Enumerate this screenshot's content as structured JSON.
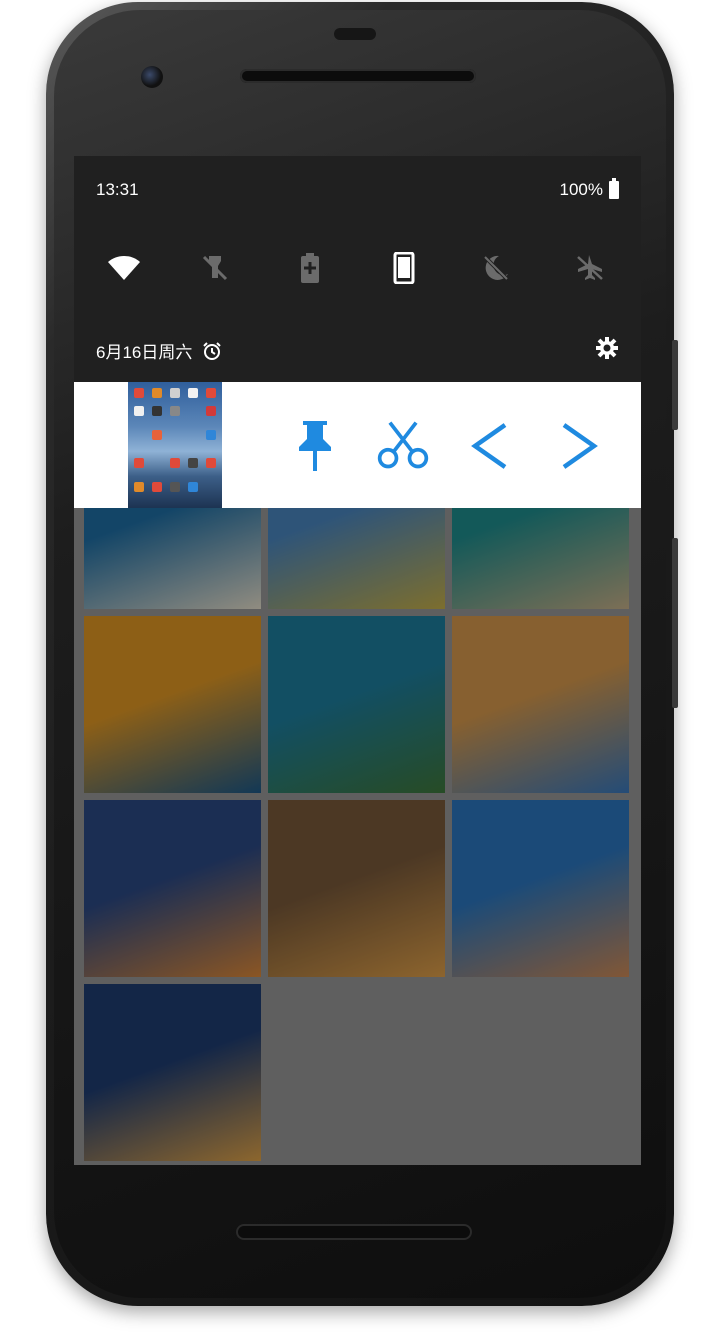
{
  "status_bar": {
    "time": "13:31",
    "battery": "100%"
  },
  "quick_settings": [
    "wifi-icon",
    "flashlight-off-icon",
    "battery-saver-icon",
    "phone-screen-icon",
    "night-light-off-icon",
    "airplane-mode-off-icon"
  ],
  "date_line": {
    "date": "6月16日周六"
  },
  "notification": {
    "actions": [
      {
        "name": "pin-button",
        "icon": "pin-icon"
      },
      {
        "name": "scissors-button",
        "icon": "scissors-icon"
      },
      {
        "name": "previous-button",
        "icon": "chevron-left-icon"
      },
      {
        "name": "next-button",
        "icon": "chevron-right-icon"
      }
    ]
  },
  "gallery": {
    "photos": [
      {
        "name": "photo-striped-abstract",
        "colors": [
          "#1e6fa6",
          "#e9e2cf"
        ]
      },
      {
        "name": "photo-poppy-field",
        "colors": [
          "#4b88c2",
          "#c9b24a"
        ]
      },
      {
        "name": "photo-coastline-aerial",
        "colors": [
          "#1f8f8f",
          "#c9b38a"
        ]
      },
      {
        "name": "photo-orange-popsicles",
        "colors": [
          "#e49a24",
          "#1d5a8a"
        ]
      },
      {
        "name": "photo-sea-cliffs",
        "colors": [
          "#1d7fa0",
          "#3f7a3c"
        ]
      },
      {
        "name": "photo-temple-columns",
        "colors": [
          "#d99b4d",
          "#3a7ac0"
        ]
      },
      {
        "name": "photo-winter-camp",
        "colors": [
          "#2c4a86",
          "#e08b3a"
        ]
      },
      {
        "name": "photo-rock-arch",
        "colors": [
          "#7a5a3a",
          "#e3a24a"
        ]
      },
      {
        "name": "photo-desert-tree",
        "colors": [
          "#2b78c2",
          "#d18c57"
        ]
      },
      {
        "name": "photo-westminster-night",
        "colors": [
          "#1e3d73",
          "#e2a54a"
        ]
      }
    ]
  },
  "colors": {
    "accent": "#1f8ae0",
    "shade": "#202020",
    "overlay": "#5f5f5f"
  }
}
